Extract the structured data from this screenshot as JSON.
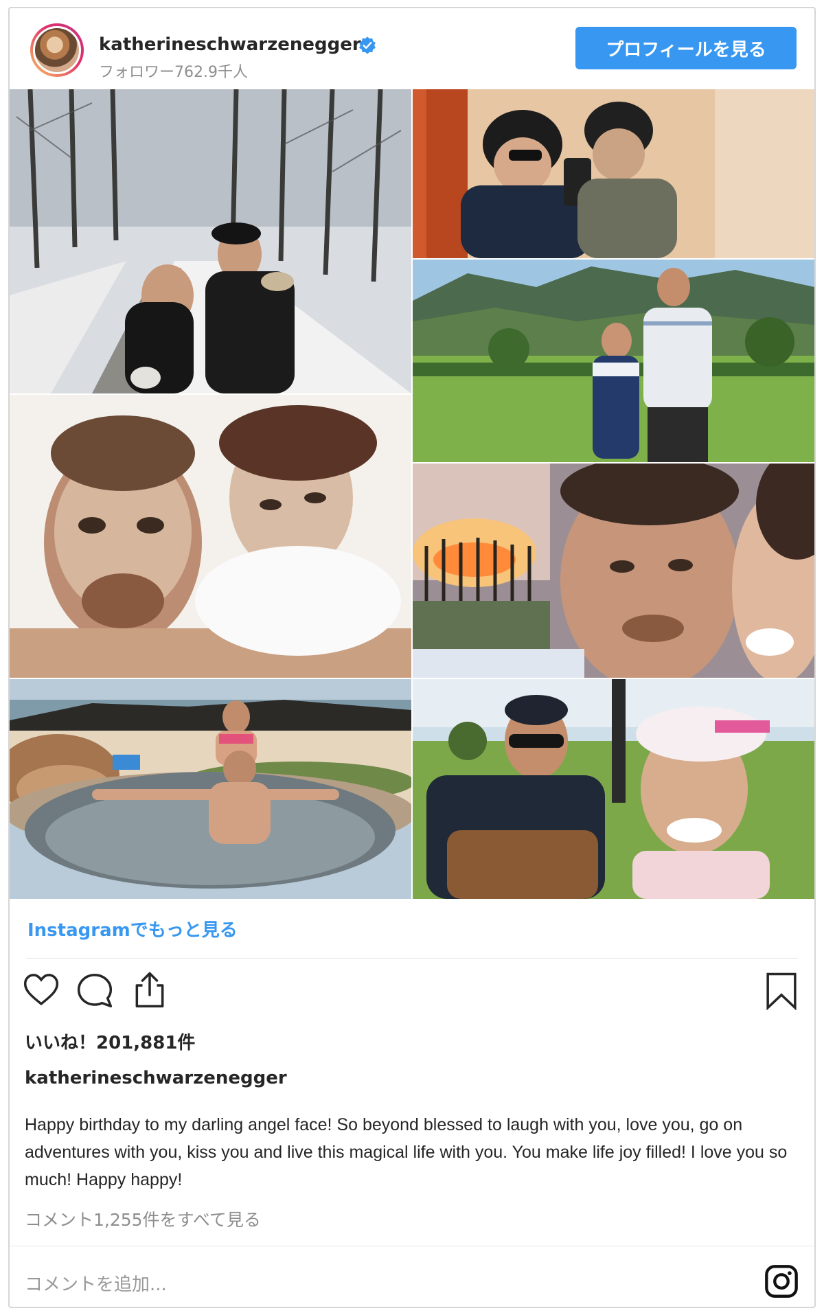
{
  "header": {
    "username": "katherineschwarzenegger",
    "followers": "フォロワー762.9千人",
    "profile_button": "プロフィールを見る"
  },
  "photos": [
    {
      "name": "photo-snow-walk",
      "icon": "photo"
    },
    {
      "name": "photo-bike-helmet-mirror-selfie",
      "icon": "photo"
    },
    {
      "name": "photo-golf-course-mountains",
      "icon": "photo"
    },
    {
      "name": "photo-face-masks-in-bed",
      "icon": "photo"
    },
    {
      "name": "photo-sunset-selfie",
      "icon": "photo"
    },
    {
      "name": "photo-beach-hot-tub",
      "icon": "photo"
    },
    {
      "name": "photo-golf-cart-selfie",
      "icon": "photo"
    }
  ],
  "more_link": "Instagramでもっと見る",
  "actions": {
    "like_icon": "heart-icon",
    "comment_icon": "comment-icon",
    "share_icon": "share-icon",
    "save_icon": "bookmark-icon"
  },
  "likes": "いいね！201,881件",
  "author": "katherineschwarzenegger",
  "caption": "Happy birthday to my darling angel face! So beyond blessed to laugh with you, love you, go on adventures with you, kiss you and live this magical life with you. You make life joy filled! I love you so much! Happy happy!",
  "view_comments": "コメント1,255件をすべて見る",
  "add_comment_placeholder": "コメントを追加...",
  "colors": {
    "accent": "#3897f0",
    "text": "#262626",
    "muted": "#8e8e8e",
    "border": "#d6d6d6"
  }
}
